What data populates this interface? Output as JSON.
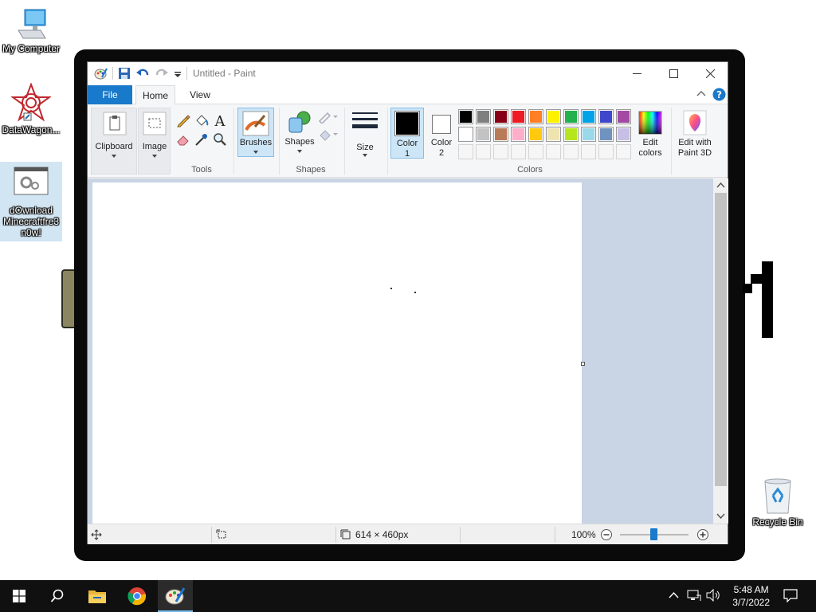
{
  "desktop": {
    "icons": [
      {
        "label": "My Computer"
      },
      {
        "label": "DataWagon..."
      },
      {
        "label": "dOwnload Minecraftfre3 n0w!"
      },
      {
        "label": "Recycle Bin"
      }
    ]
  },
  "paint": {
    "title": "Untitled - Paint",
    "tabs": {
      "file": "File",
      "home": "Home",
      "view": "View"
    },
    "ribbon": {
      "clipboard": "Clipboard",
      "image": "Image",
      "tools_group": "Tools",
      "brushes": "Brushes",
      "shapes_button": "Shapes",
      "shapes_group": "Shapes",
      "size": "Size",
      "color1_line1": "Color",
      "color1_line2": "1",
      "color2_line1": "Color",
      "color2_line2": "2",
      "edit_colors_line1": "Edit",
      "edit_colors_line2": "colors",
      "edit_paint3d_line1": "Edit with",
      "edit_paint3d_line2": "Paint 3D",
      "colors_group": "Colors"
    },
    "colors": {
      "color1": "#000000",
      "color2": "#ffffff",
      "palette_row1": [
        "#000000",
        "#7f7f7f",
        "#880015",
        "#ed1c24",
        "#ff7f27",
        "#fff200",
        "#22b14c",
        "#00a2e8",
        "#3f48cc",
        "#a349a4"
      ],
      "palette_row2": [
        "#ffffff",
        "#c3c3c3",
        "#b97a57",
        "#ffaec9",
        "#ffc90e",
        "#efe4b0",
        "#b5e61d",
        "#99d9ea",
        "#7092be",
        "#c8bfe7"
      ],
      "palette_row3": [
        "#f6f6f6",
        "#f6f6f6",
        "#f6f6f6",
        "#f6f6f6",
        "#f6f6f6",
        "#f6f6f6",
        "#f6f6f6",
        "#f6f6f6",
        "#f6f6f6",
        "#f6f6f6"
      ],
      "accent": "#1979ca"
    },
    "status": {
      "canvas_size": "614 × 460px",
      "zoom": "100%"
    }
  },
  "taskbar": {
    "time": "5:48 AM",
    "date": "3/7/2022"
  }
}
